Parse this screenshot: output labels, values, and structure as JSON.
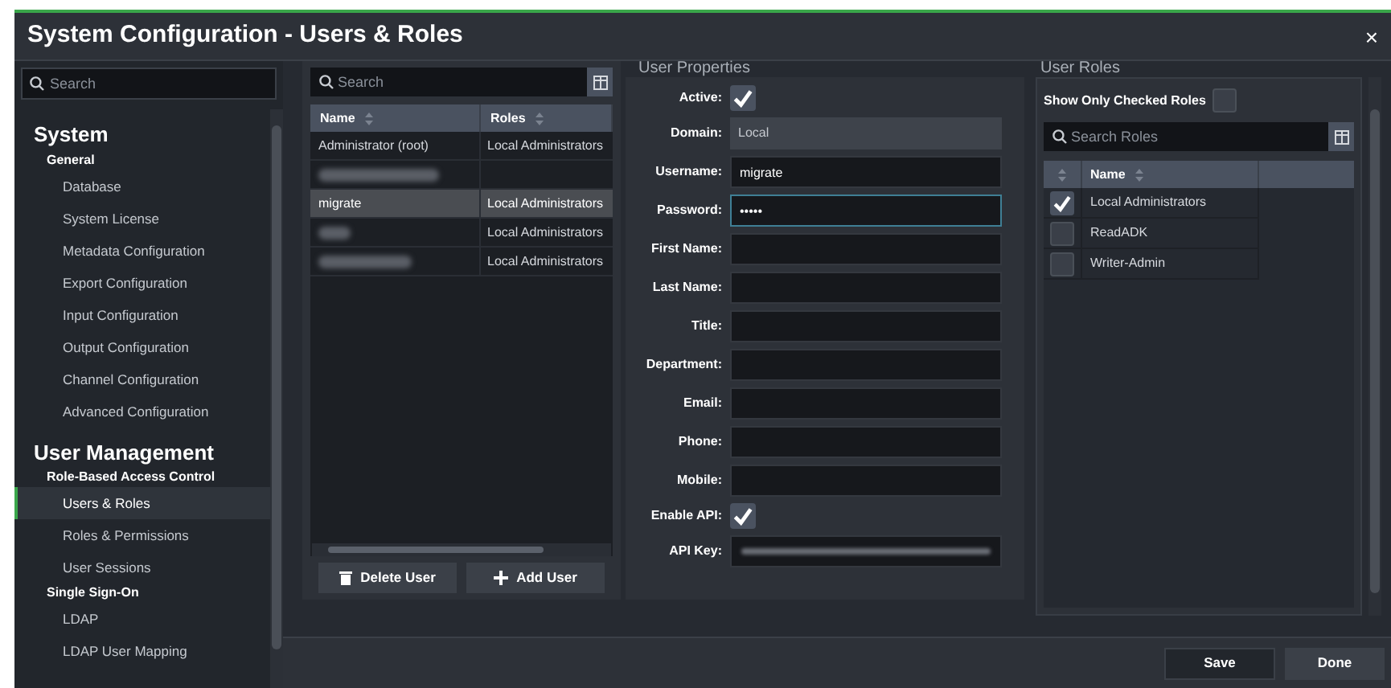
{
  "window": {
    "title": "System Configuration - Users & Roles",
    "close": "×"
  },
  "sidebar": {
    "search": {
      "placeholder": "Search"
    },
    "sections": [
      {
        "title": "System",
        "groups": [
          {
            "title": "General",
            "items": [
              {
                "label": "Database",
                "selected": false
              },
              {
                "label": "System License",
                "selected": false
              },
              {
                "label": "Metadata Configuration",
                "selected": false
              },
              {
                "label": "Export Configuration",
                "selected": false
              },
              {
                "label": "Input Configuration",
                "selected": false
              },
              {
                "label": "Output Configuration",
                "selected": false
              },
              {
                "label": "Channel Configuration",
                "selected": false
              },
              {
                "label": "Advanced Configuration",
                "selected": false
              }
            ]
          }
        ]
      },
      {
        "title": "User Management",
        "groups": [
          {
            "title": "Role-Based Access Control",
            "items": [
              {
                "label": "Users & Roles",
                "selected": true
              },
              {
                "label": "Roles & Permissions",
                "selected": false
              },
              {
                "label": "User Sessions",
                "selected": false
              }
            ]
          },
          {
            "title": "Single Sign-On",
            "items": [
              {
                "label": "LDAP",
                "selected": false
              },
              {
                "label": "LDAP User Mapping",
                "selected": false
              }
            ]
          }
        ]
      }
    ]
  },
  "users": {
    "search": {
      "placeholder": "Search"
    },
    "columns": [
      "Name",
      "Roles"
    ],
    "rows": [
      {
        "name": "Administrator (root)",
        "roles": "Local Administrators",
        "redacted": false,
        "selected": false
      },
      {
        "redacted": true,
        "selected": false
      },
      {
        "name": "migrate",
        "roles": "Local Administrators",
        "redacted": false,
        "selected": true
      },
      {
        "roles": "Local Administrators",
        "redacted": true,
        "selected": false
      },
      {
        "roles": "Local Administrators",
        "redacted": true,
        "selected": false
      }
    ],
    "buttons": [
      {
        "label": "Delete User",
        "kind": "delete"
      },
      {
        "label": "Add User",
        "kind": "add"
      }
    ]
  },
  "properties": {
    "title": "User Properties",
    "fields": [
      {
        "label": "Active:",
        "kind": "checkbox",
        "checked": true
      },
      {
        "label": "Domain:",
        "kind": "readonly",
        "value": "Local"
      },
      {
        "label": "Username:",
        "kind": "text",
        "value": "migrate"
      },
      {
        "label": "Password:",
        "kind": "text",
        "value": "•••••",
        "focused": true
      },
      {
        "label": "First Name:",
        "kind": "text"
      },
      {
        "label": "Last Name:",
        "kind": "text"
      },
      {
        "label": "Title:",
        "kind": "text"
      },
      {
        "label": "Department:",
        "kind": "text"
      },
      {
        "label": "Email:",
        "kind": "text"
      },
      {
        "label": "Phone:",
        "kind": "text"
      },
      {
        "label": "Mobile:",
        "kind": "text"
      },
      {
        "label": "Enable API:",
        "kind": "checkbox",
        "checked": true
      },
      {
        "label": "API Key:",
        "kind": "redacted"
      }
    ]
  },
  "roles": {
    "title": "User Roles",
    "show_only_checked": {
      "label": "Show Only Checked Roles",
      "checked": false
    },
    "search": {
      "placeholder": "Search Roles"
    },
    "columns": [
      "Name"
    ],
    "rows": [
      {
        "name": "Local Administrators",
        "checked": true
      },
      {
        "name": "ReadADK",
        "checked": false
      },
      {
        "name": "Writer-Admin",
        "checked": false
      }
    ]
  },
  "footer": {
    "buttons": [
      {
        "label": "Save",
        "kind": "secondary"
      },
      {
        "label": "Done",
        "kind": "primary"
      }
    ]
  }
}
